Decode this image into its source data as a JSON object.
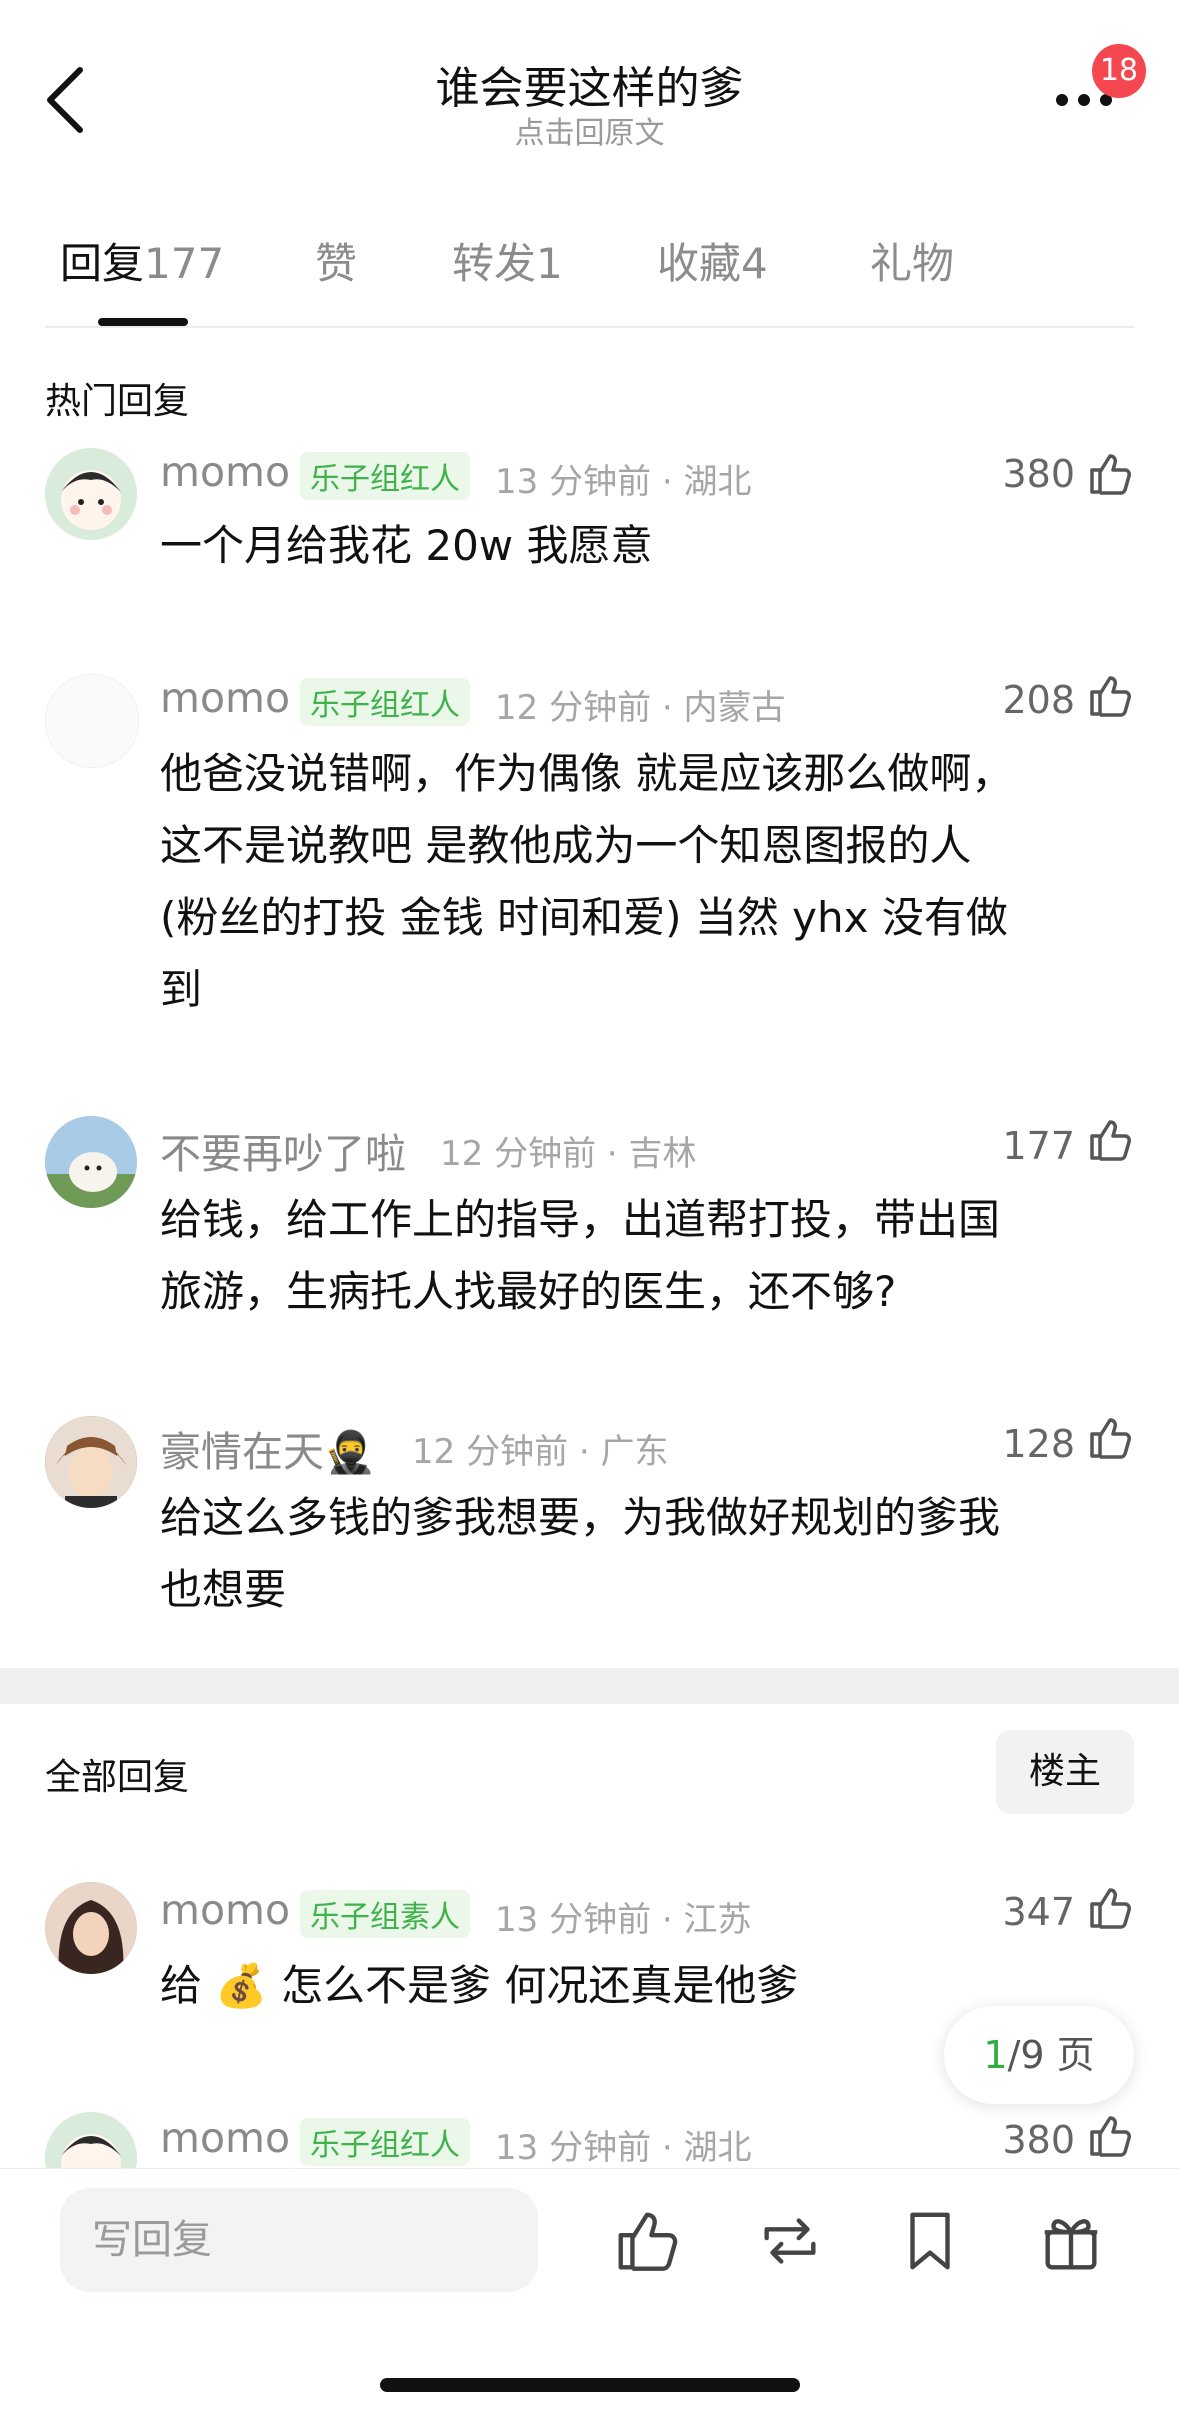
{
  "header": {
    "title": "谁会要这样的爹",
    "subtitle": "点击回原文",
    "badge": "18"
  },
  "tabs": [
    {
      "label": "回复",
      "count": "177"
    },
    {
      "label": "赞",
      "count": ""
    },
    {
      "label": "转发",
      "count": "1"
    },
    {
      "label": "收藏",
      "count": "4"
    },
    {
      "label": "礼物",
      "count": ""
    }
  ],
  "hot_section_title": "热门回复",
  "hot_comments": [
    {
      "user": "momo",
      "tag": "乐子组红人",
      "time": "13 分钟前 · 湖北",
      "likes": "380",
      "lines": [
        "一个月给我花 20w 我愿意"
      ]
    },
    {
      "user": "momo",
      "tag": "乐子组红人",
      "time": "12 分钟前 · 内蒙古",
      "likes": "208",
      "lines": [
        "他爸没说错啊，作为偶像 就是应该那么做啊，",
        "这不是说教吧 是教他成为一个知恩图报的人",
        "(粉丝的打投 金钱 时间和爱) 当然 yhx 没有做",
        "到"
      ]
    },
    {
      "user": "不要再吵了啦",
      "tag": "",
      "time": "12 分钟前 · 吉林",
      "likes": "177",
      "lines": [
        "给钱，给工作上的指导，出道帮打投，带出国",
        "旅游，生病托人找最好的医生，还不够?"
      ]
    },
    {
      "user": "豪情在天🥷",
      "tag": "",
      "time": "12 分钟前 · 广东",
      "likes": "128",
      "lines": [
        "给这么多钱的爹我想要，为我做好规划的爹我",
        "也想要"
      ]
    }
  ],
  "all_section_title": "全部回复",
  "owner_button": "楼主",
  "all_comments": [
    {
      "user": "momo",
      "tag": "乐子组素人",
      "time": "13 分钟前 · 江苏",
      "likes": "347",
      "lines": [
        "给 💰 怎么不是爹  何况还真是他爹"
      ]
    },
    {
      "user": "momo",
      "tag": "乐子组红人",
      "time": "13 分钟前 · 湖北",
      "likes": "380",
      "lines": []
    }
  ],
  "pager": {
    "current": "1",
    "total": "/9 页"
  },
  "bottom_bar": {
    "reply_placeholder": "写回复"
  },
  "colors": {
    "accent_green": "#3fb24c",
    "badge_red": "#f4474f"
  }
}
